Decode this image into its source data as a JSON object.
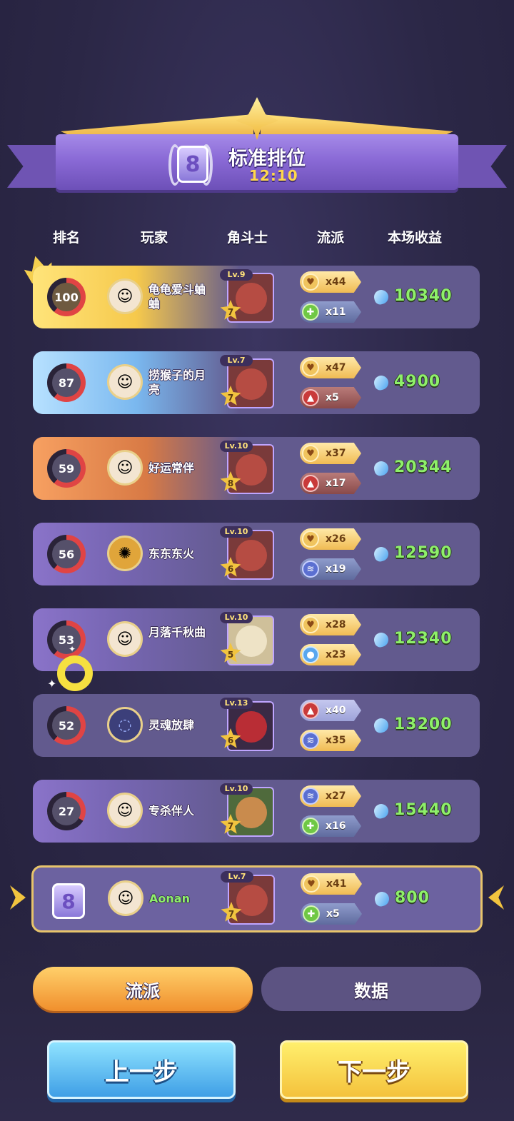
{
  "banner": {
    "rank_badge": "8",
    "title": "标准排位",
    "time": "12:10"
  },
  "headers": {
    "rank": "排名",
    "player": "玩家",
    "gladiator": "角斗士",
    "faction": "流派",
    "earnings": "本场收益"
  },
  "rows": [
    {
      "rank": "100",
      "name": "龟龟爱斗蛐蛐",
      "level": "Lv.9",
      "star": "7",
      "tag1": "x44",
      "tag2": "x11",
      "earn": "10340",
      "style": "gold"
    },
    {
      "rank": "87",
      "name": "捞猴子的月亮",
      "level": "Lv.7",
      "star": "7",
      "tag1": "x47",
      "tag2": "x5",
      "earn": "4900",
      "style": "blue"
    },
    {
      "rank": "59",
      "name": "好运常伴",
      "level": "Lv.10",
      "star": "8",
      "tag1": "x37",
      "tag2": "x17",
      "earn": "20344",
      "style": "orange"
    },
    {
      "rank": "56",
      "name": "东东东火",
      "level": "Lv.10",
      "star": "6",
      "tag1": "x26",
      "tag2": "x19",
      "earn": "12590",
      "style": "purple"
    },
    {
      "rank": "53",
      "name": "月落千秋曲",
      "level": "Lv.10",
      "star": "5",
      "tag1": "x28",
      "tag2": "x23",
      "earn": "12340",
      "style": "purple"
    },
    {
      "rank": "52",
      "name": "灵魂放肆",
      "level": "Lv.13",
      "star": "6",
      "tag1": "x40",
      "tag2": "x35",
      "earn": "13200",
      "style": "plain"
    },
    {
      "rank": "27",
      "name": "专杀伴人",
      "level": "Lv.10",
      "star": "7",
      "tag1": "x27",
      "tag2": "x16",
      "earn": "15440",
      "style": "purple"
    },
    {
      "rank": "8",
      "name": "Aonan",
      "level": "Lv.7",
      "star": "7",
      "tag1": "x41",
      "tag2": "x5",
      "earn": "800",
      "style": "me"
    }
  ],
  "tabs": {
    "faction": "流派",
    "data": "数据"
  },
  "buttons": {
    "prev": "上一步",
    "next": "下一步"
  },
  "colors": {
    "accent_gold": "#f2c43f",
    "earn_green": "#8ef06a",
    "bg": "#2d2848"
  }
}
